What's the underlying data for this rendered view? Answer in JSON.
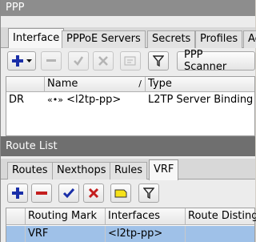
{
  "ppp": {
    "title": "PPP",
    "tabs": [
      "Interface",
      "PPPoE Servers",
      "Secrets",
      "Profiles",
      "Ac"
    ],
    "scanner_label": "PPP Scanner",
    "columns": [
      "Name",
      "Type"
    ],
    "rows": [
      {
        "flag": "DR",
        "icon": "«•»",
        "name": "<l2tp-pp>",
        "type": "L2TP Server Binding"
      }
    ]
  },
  "route_list": {
    "title": "Route List",
    "tabs": [
      "Routes",
      "Nexthops",
      "Rules",
      "VRF"
    ],
    "columns": [
      "Routing Mark",
      "Interfaces",
      "Route Distingu"
    ],
    "rows": [
      {
        "routing_mark": "VRF",
        "interfaces": "<l2tp-pp>",
        "route_distinguisher": ""
      }
    ]
  },
  "colors": {
    "selection": "#9fc1e8",
    "titlebar": "#8d8d8d",
    "add_icon": "#1a2fa8",
    "remove_icon": "#c41e1e"
  }
}
